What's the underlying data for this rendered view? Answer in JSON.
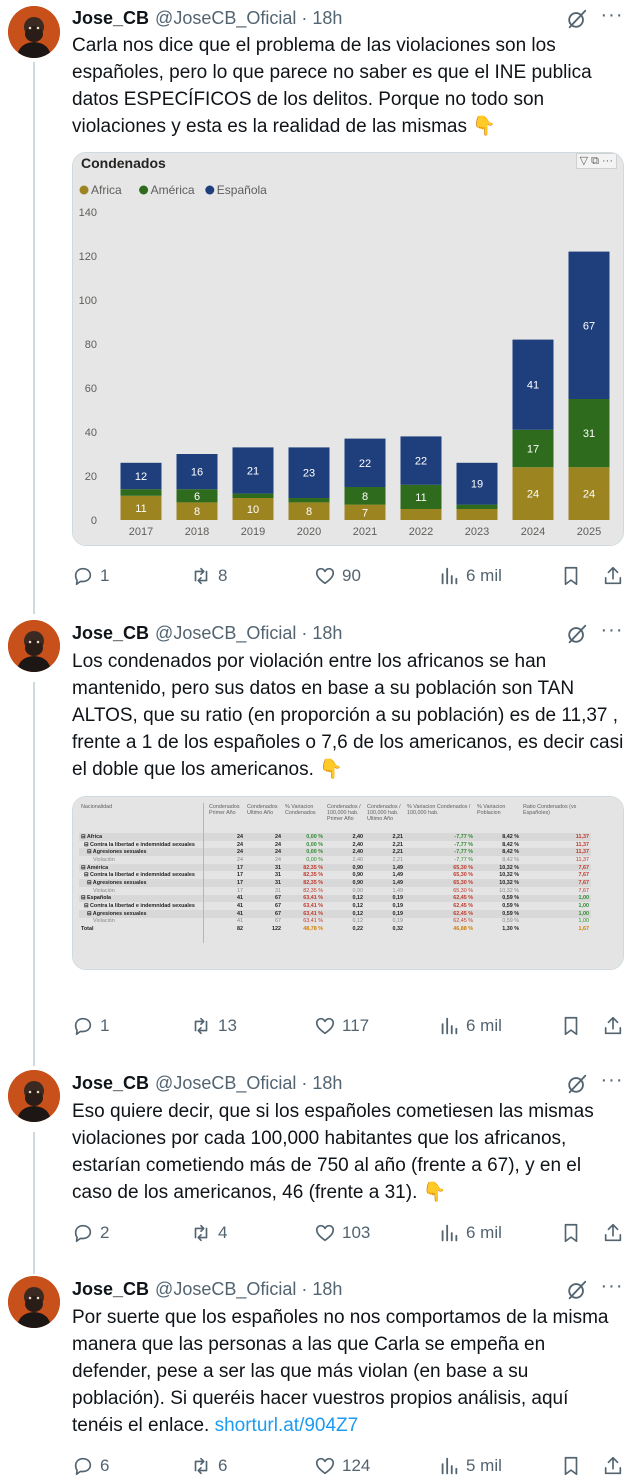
{
  "tweets": [
    {
      "name": "Jose_CB",
      "handle": "@JoseCB_Oficial",
      "time": "18h",
      "text": "Carla nos dice que el problema de las violaciones son los españoles, pero lo que parece no saber es que el INE publica datos ESPECÍFICOS de los delitos. Porque no todo son violaciones y esta es la realidad de las mismas 👇",
      "replies": "1",
      "reposts": "8",
      "likes": "90",
      "views": "6 mil"
    },
    {
      "name": "Jose_CB",
      "handle": "@JoseCB_Oficial",
      "time": "18h",
      "text": "Los condenados por violación entre los africanos se han mantenido, pero sus datos en base a su población son TAN ALTOS, que su ratio (en proporción a su población) es de 11,37 , frente a 1 de los españoles o 7,6 de los americanos, es decir casi el doble que los americanos. 👇",
      "replies": "1",
      "reposts": "13",
      "likes": "117",
      "views": "6 mil"
    },
    {
      "name": "Jose_CB",
      "handle": "@JoseCB_Oficial",
      "time": "18h",
      "text": "Eso quiere decir, que si los españoles cometiesen las mismas violaciones por cada 100,000 habitantes que los africanos, estarían cometiendo más de 750 al año (frente a 67), y en el caso de los americanos, 46 (frente a 31). 👇",
      "replies": "2",
      "reposts": "4",
      "likes": "103",
      "views": "6 mil"
    },
    {
      "name": "Jose_CB",
      "handle": "@JoseCB_Oficial",
      "time": "18h",
      "text": "Por suerte que los españoles no nos comportamos de la misma manera que las personas a las que Carla se empeña en defender, pese a ser las que más violan (en base a su población). Si queréis hacer vuestros propios análisis, aquí tenéis el enlace. ",
      "link": "shorturl.at/904Z7",
      "replies": "6",
      "reposts": "6",
      "likes": "124",
      "views": "5 mil"
    }
  ],
  "icons": [
    "reply-icon",
    "repost-icon",
    "like-icon",
    "views-icon",
    "bookmark-icon",
    "share-icon",
    "grok-icon",
    "more-icon"
  ],
  "chart_data": {
    "type": "bar",
    "stacked": true,
    "title": "Condenados",
    "categories": [
      "2017",
      "2018",
      "2019",
      "2020",
      "2021",
      "2022",
      "2023",
      "2024",
      "2025"
    ],
    "series": [
      {
        "name": "Africa",
        "color": "#9c8521",
        "values": [
          11,
          8,
          10,
          8,
          7,
          5,
          5,
          24,
          24
        ],
        "labels": [
          "11",
          "8",
          "10",
          "8",
          "7",
          "",
          "",
          "24",
          "24"
        ]
      },
      {
        "name": "América",
        "color": "#2e6b1d",
        "values": [
          3,
          6,
          2,
          2,
          8,
          11,
          2,
          17,
          31
        ],
        "labels": [
          "",
          "6",
          "",
          "",
          "8",
          "11",
          "",
          "17",
          "31"
        ]
      },
      {
        "name": "Española",
        "color": "#1f3f7c",
        "values": [
          12,
          16,
          21,
          23,
          22,
          22,
          19,
          41,
          67
        ],
        "labels": [
          "12",
          "16",
          "21",
          "23",
          "22",
          "22",
          "19",
          "41",
          "67"
        ]
      }
    ],
    "ylim": [
      0,
      140
    ],
    "yticks": [
      0,
      20,
      40,
      60,
      80,
      100,
      120,
      140
    ],
    "legend": "top-left",
    "grid": false
  },
  "table": {
    "headers": [
      "Nacionalidad",
      "Condenados Primer Año",
      "Condenados Ultimo Año",
      "% Variacion Condenados",
      "Condenados / 100,000 hab. Primer Año",
      "Condenados / 100,000 hab. Ultimo Año",
      "% Variacion Condenados / 100,000 hab.",
      "% Variacion Poblacion",
      "Ratio Condenados (vs Españoles)"
    ],
    "rows": [
      {
        "cells": [
          "⊟ Africa",
          "24",
          "24",
          "0,00 %",
          "2,40",
          "2,21",
          "-7,77 %",
          "8,42 %",
          "11,37"
        ],
        "style": "b alt"
      },
      {
        "cells": [
          "  ⊟ Contra la libertad e indemnidad sexuales",
          "24",
          "24",
          "0,00 %",
          "2,40",
          "2,21",
          "-7,77 %",
          "8,42 %",
          "11,37"
        ],
        "style": "b"
      },
      {
        "cells": [
          "    ⊟ Agresiones sexuales",
          "24",
          "24",
          "0,00 %",
          "2,40",
          "2,21",
          "-7,77 %",
          "8,42 %",
          "11,37"
        ],
        "style": "b alt"
      },
      {
        "cells": [
          "        Violación",
          "24",
          "24",
          "0,00 %",
          "2,40",
          "2,21",
          "-7,77 %",
          "8,42 %",
          "11,37"
        ],
        "style": "sub"
      },
      {
        "cells": [
          "⊟ América",
          "17",
          "31",
          "82,35 %",
          "0,90",
          "1,49",
          "65,30 %",
          "10,32 %",
          "7,67"
        ],
        "style": "b alt"
      },
      {
        "cells": [
          "  ⊟ Contra la libertad e indemnidad sexuales",
          "17",
          "31",
          "82,35 %",
          "0,90",
          "1,49",
          "65,30 %",
          "10,32 %",
          "7,67"
        ],
        "style": "b"
      },
      {
        "cells": [
          "    ⊟ Agresiones sexuales",
          "17",
          "31",
          "82,35 %",
          "0,90",
          "1,49",
          "65,30 %",
          "10,32 %",
          "7,67"
        ],
        "style": "b alt"
      },
      {
        "cells": [
          "        Violación",
          "17",
          "31",
          "82,35 %",
          "0,90",
          "1,49",
          "65,30 %",
          "10,32 %",
          "7,67"
        ],
        "style": "sub"
      },
      {
        "cells": [
          "⊟ Española",
          "41",
          "67",
          "63,41 %",
          "0,12",
          "0,19",
          "62,45 %",
          "0,59 %",
          "1,00"
        ],
        "style": "b alt"
      },
      {
        "cells": [
          "  ⊟ Contra la libertad e indemnidad sexuales",
          "41",
          "67",
          "63,41 %",
          "0,12",
          "0,19",
          "62,45 %",
          "0,59 %",
          "1,00"
        ],
        "style": "b"
      },
      {
        "cells": [
          "    ⊟ Agresiones sexuales",
          "41",
          "67",
          "63,41 %",
          "0,12",
          "0,19",
          "62,45 %",
          "0,59 %",
          "1,00"
        ],
        "style": "b alt"
      },
      {
        "cells": [
          "        Violación",
          "41",
          "67",
          "63,41 %",
          "0,12",
          "0,19",
          "62,45 %",
          "0,59 %",
          "1,00"
        ],
        "style": "sub"
      },
      {
        "cells": [
          "Total",
          "82",
          "122",
          "48,78 %",
          "0,22",
          "0,32",
          "46,88 %",
          "1,30 %",
          "1,67"
        ],
        "style": "b"
      }
    ]
  }
}
